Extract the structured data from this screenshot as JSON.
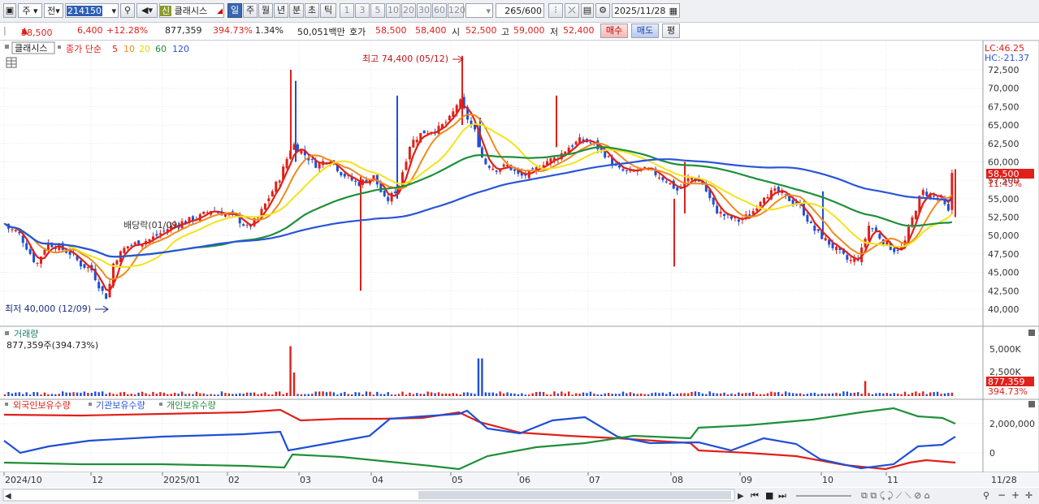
{
  "toolbar": {
    "period_label": "주",
    "prev_label": "전",
    "code": "214150",
    "new_badge": "신",
    "stock_name": "클래시스",
    "period_tabs": [
      "일",
      "주",
      "월",
      "년",
      "분",
      "초",
      "틱"
    ],
    "interval_tabs": [
      "1",
      "3",
      "5",
      "10",
      "20",
      "30",
      "60",
      "120"
    ],
    "count": "265",
    "count_total": "/600",
    "date": "2025/11/28"
  },
  "info": {
    "price": "58,500",
    "change": "6,400",
    "change_pct": "+12.28%",
    "volume": "877,359",
    "volume_ratio": "394.73%",
    "turnover": "1.34%",
    "amount": "50,051백만",
    "quote_label": "호가",
    "ask": "58,500",
    "bid": "58,400",
    "open_label": "시",
    "open": "52,500",
    "high_label": "고",
    "high": "59,000",
    "low_label": "저",
    "low": "52,400",
    "buy_label": "매수",
    "sell_label": "매도",
    "eval_label": "평"
  },
  "price_panel": {
    "stock_label": "클래시스",
    "ma_title": "종가 단순",
    "ma_periods": [
      "5",
      "10",
      "20",
      "60",
      "120"
    ],
    "lc": "LC:46.25",
    "hc": "HC:-21.37",
    "high_note": "최고 74,400 (05/12)",
    "low_note": "최저 40,000 (12/09)",
    "dividend_note": "배당락(01/09)",
    "current_tag": "58,500",
    "current_pct": "11.43%",
    "y_ticks": [
      "72,500",
      "70,000",
      "67,500",
      "65,000",
      "62,500",
      "60,000",
      "57,500",
      "55,000",
      "52,500",
      "50,000",
      "47,500",
      "45,000",
      "42,500",
      "40,000"
    ]
  },
  "volume_panel": {
    "title": "거래량",
    "value": "877,359주(394.73%)",
    "y_ticks": [
      "5,000K",
      "2,500K"
    ],
    "current_tag": "877,359",
    "current_pct": "394.73%"
  },
  "holdings_panel": {
    "legend": [
      "외국인보유수량",
      "기관보유수량",
      "개인보유수량"
    ],
    "y_ticks": [
      "2,000,000",
      "0"
    ]
  },
  "x_axis": {
    "labels": [
      "2024/10",
      "12",
      "2025/01",
      "02",
      "03",
      "04",
      "05",
      "06",
      "07",
      "08",
      "09",
      "10",
      "11"
    ],
    "right_label": "11/28"
  },
  "colors": {
    "up": "#e0201a",
    "down": "#1e4fd6",
    "ma5": "#e0201a",
    "ma10": "#f08a1c",
    "ma20": "#f2e31a",
    "ma60": "#1f8f3a",
    "ma120": "#2a55d8"
  }
}
